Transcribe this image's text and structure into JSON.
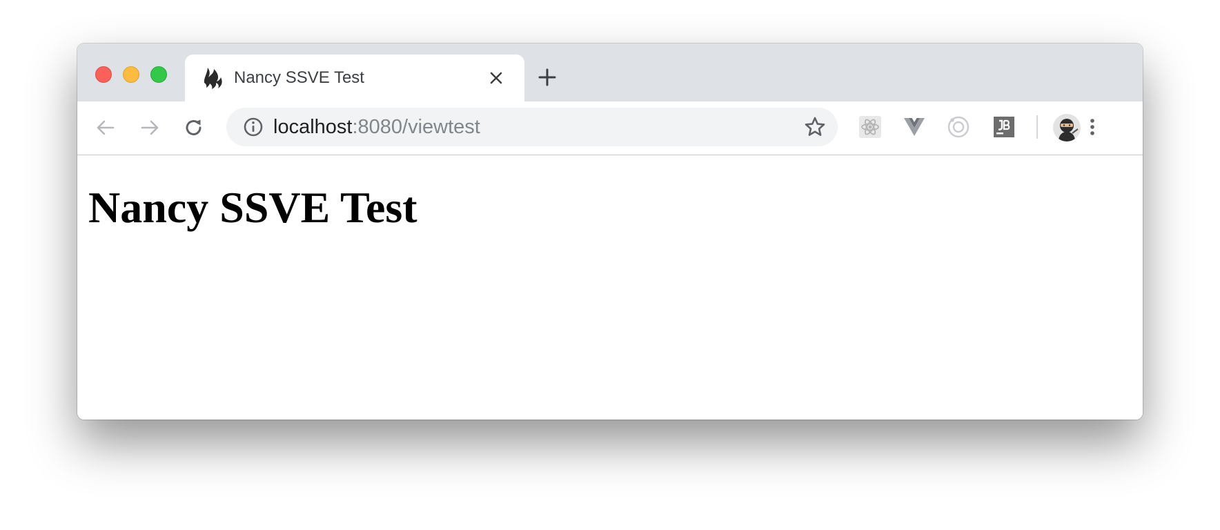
{
  "window": {
    "controls": {
      "close": "#fc605b",
      "minimize": "#fdbc40",
      "maximize": "#34c84a"
    }
  },
  "tab": {
    "title": "Nancy SSVE Test",
    "favicon": "flame-icon"
  },
  "toolbar": {
    "url_host": "localhost",
    "url_path": ":8080/viewtest",
    "icons": [
      "back-arrow-icon",
      "forward-arrow-icon",
      "reload-icon",
      "info-icon",
      "star-icon",
      "react-extension-icon",
      "vue-extension-icon",
      "circle-extension-icon",
      "jetbrains-extension-icon",
      "avatar",
      "menu-dots-icon"
    ]
  },
  "page": {
    "heading": "Nancy SSVE Test"
  },
  "colors": {
    "tabstrip": "#dee1e6",
    "omnibox": "#f1f3f4",
    "url_path": "#80868b"
  }
}
